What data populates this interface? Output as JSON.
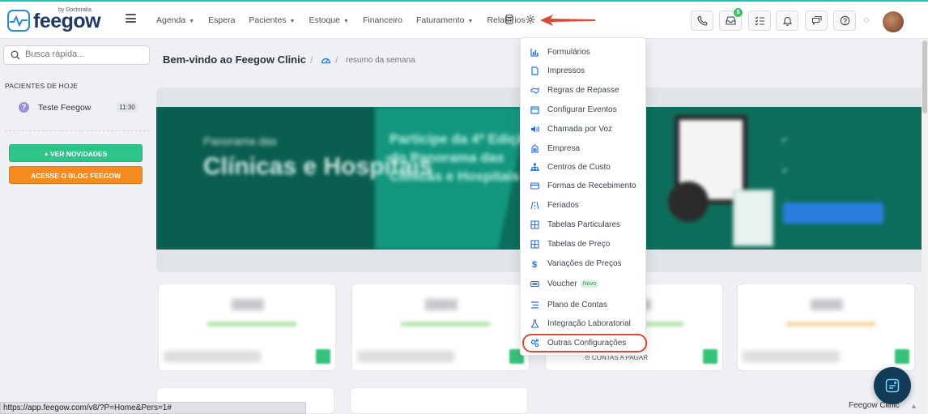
{
  "app": {
    "logo_text": "feegow",
    "logo_by": "by Doctoralia"
  },
  "nav": {
    "items": [
      {
        "label": "Agenda",
        "caret": true
      },
      {
        "label": "Espera",
        "caret": false
      },
      {
        "label": "Pacientes",
        "caret": true
      },
      {
        "label": "Estoque",
        "caret": true
      },
      {
        "label": "Financeiro",
        "caret": false
      },
      {
        "label": "Faturamento",
        "caret": true
      },
      {
        "label": "Relatórios",
        "caret": false
      }
    ],
    "caret_glyph": "▼"
  },
  "toolbar": {
    "notification_badge": "$"
  },
  "sidebar": {
    "search_placeholder": "Busca rápida...",
    "patients_today_label": "PACIENTES DE HOJE",
    "patient": {
      "name": "Teste Feegow",
      "time": "11:30"
    },
    "btn_news": "+ VER NOVIDADES",
    "btn_blog": "ACESSE O BLOG FEEGOW"
  },
  "main": {
    "title": "Bem-vindo ao Feegow Clinic",
    "breadcrumb": "resumo da semana",
    "contas_label": "CONTAS A PAGAR",
    "banner": {
      "brand": "Panorama das",
      "headline": "Clínicas e Hospitais",
      "cta_title": "Participe da 4ª Edição do Panorama das Clínicas e Hospitais"
    }
  },
  "settings_menu": {
    "items": [
      {
        "label": "Formulários",
        "icon": "chart-icon"
      },
      {
        "label": "Impressos",
        "icon": "document-icon"
      },
      {
        "label": "Regras de Repasse",
        "icon": "handshake-icon"
      },
      {
        "label": "Configurar Eventos",
        "icon": "calendar-icon"
      },
      {
        "label": "Chamada por Voz",
        "icon": "speaker-icon"
      },
      {
        "label": "Empresa",
        "icon": "building-icon"
      },
      {
        "label": "Centros de Custo",
        "icon": "sitemap-icon"
      },
      {
        "label": "Formas de Recebimento",
        "icon": "card-icon"
      },
      {
        "label": "Feriados",
        "icon": "road-icon"
      },
      {
        "label": "Tabelas Particulares",
        "icon": "table-icon"
      },
      {
        "label": "Tabelas de Preço",
        "icon": "table-icon"
      },
      {
        "label": "Variações de Preços",
        "icon": "dollar-icon"
      },
      {
        "label": "Voucher",
        "icon": "ticket-icon",
        "badge": "Novo"
      },
      {
        "label": "Plano de Contas",
        "icon": "list-icon"
      },
      {
        "label": "Integração Laboratorial",
        "icon": "flask-icon"
      },
      {
        "label": "Outras Configurações",
        "icon": "cogs-icon"
      }
    ]
  },
  "statusbar": {
    "url": "https://app.feegow.com/v8/?P=Home&Pers=1#"
  },
  "footer": {
    "brand": "Feegow Clinic"
  },
  "colors": {
    "accent": "#1ec6b2",
    "brand_blue": "#2a8ae0",
    "highlight": "#d84a38",
    "green_btn": "#2fc58a",
    "orange_btn": "#f68b1f"
  }
}
